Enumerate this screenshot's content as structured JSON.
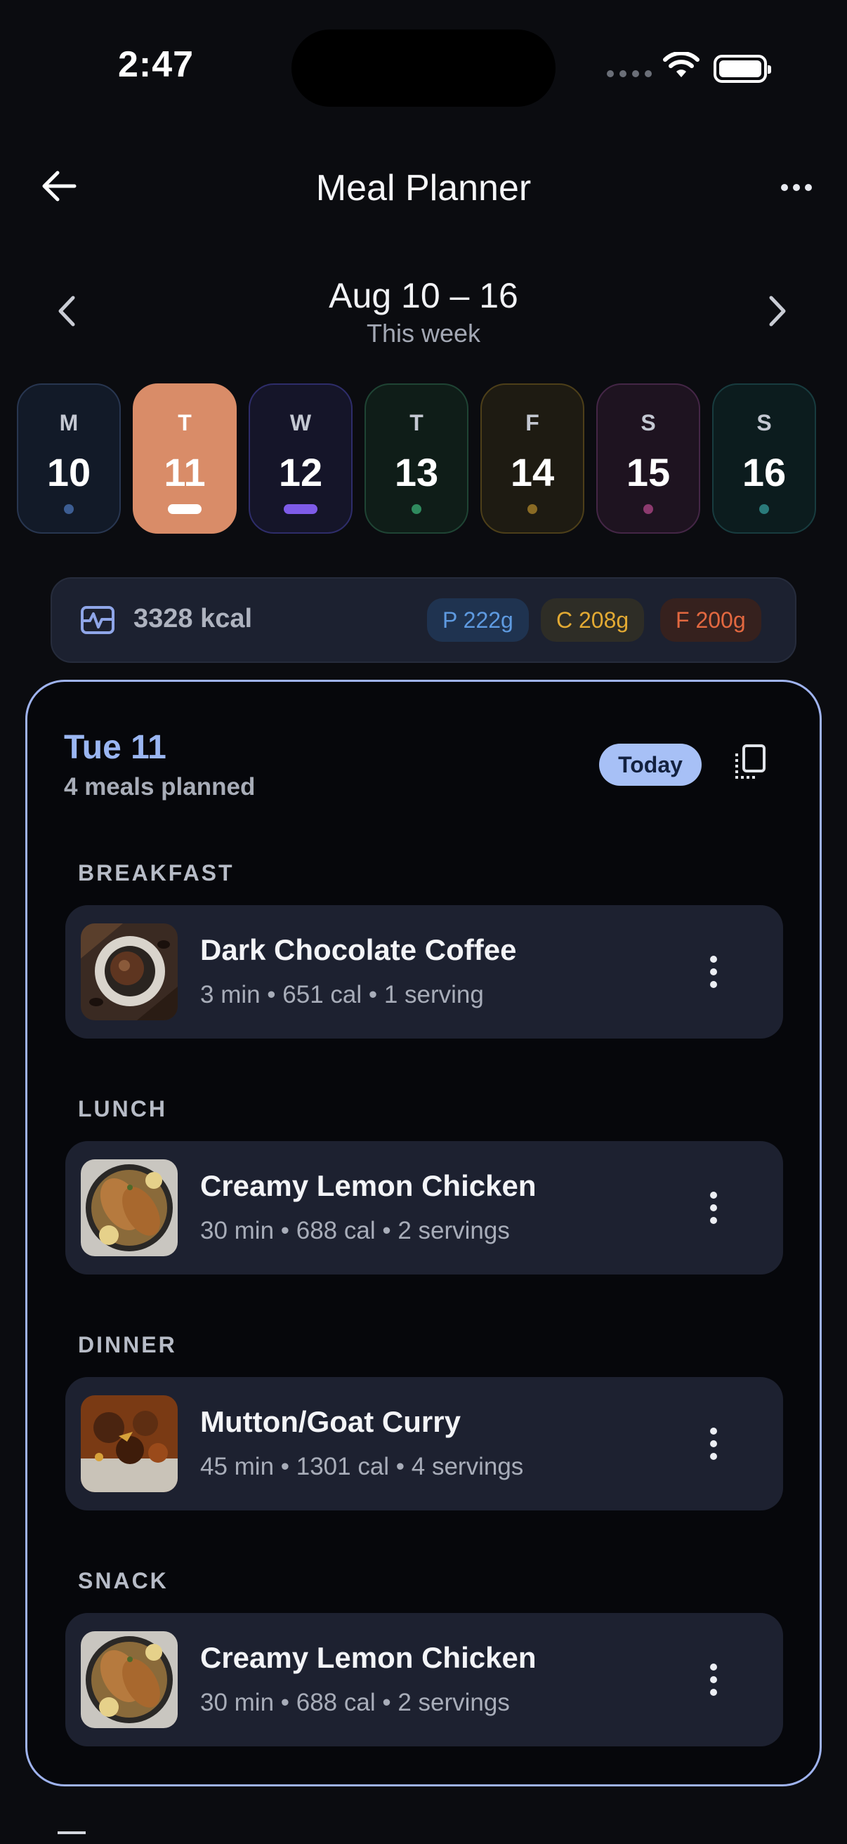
{
  "status_bar": {
    "time": "2:47"
  },
  "header": {
    "title": "Meal Planner",
    "back_icon": "arrow-left-icon",
    "menu_icon": "more-horizontal-icon"
  },
  "week": {
    "range": "Aug 10 – 16",
    "subtitle": "This week",
    "days": [
      {
        "letter": "M",
        "number": "10",
        "bg": "#121a28",
        "border": "#283650",
        "dot": "#3c5d92"
      },
      {
        "letter": "T",
        "number": "11",
        "bg": "#d98c68",
        "border": "#d98c68",
        "dot": "#ffffff",
        "selected": true
      },
      {
        "letter": "W",
        "number": "12",
        "bg": "#151529",
        "border": "#2e2d6a",
        "dot": "#7e5be8"
      },
      {
        "letter": "T",
        "number": "13",
        "bg": "#0f1d18",
        "border": "#1f4434",
        "dot": "#2f8a5e"
      },
      {
        "letter": "F",
        "number": "14",
        "bg": "#1e1b12",
        "border": "#4d3f19",
        "dot": "#8a6b24"
      },
      {
        "letter": "S",
        "number": "15",
        "bg": "#1e1320",
        "border": "#442646",
        "dot": "#8c3a6e"
      },
      {
        "letter": "S",
        "number": "16",
        "bg": "#0c1c1e",
        "border": "#183c3f",
        "dot": "#2a7a7a"
      }
    ]
  },
  "summary": {
    "kcal": "3328 kcal",
    "protein": "P 222g",
    "carbs": "C 208g",
    "fat": "F 200g"
  },
  "day_card": {
    "title": "Tue 11",
    "subtitle": "4 meals planned",
    "badge": "Today",
    "sections": [
      {
        "label": "BREAKFAST",
        "name": "Dark Chocolate Coffee",
        "meta": "3 min • 651 cal • 1 serving"
      },
      {
        "label": "LUNCH",
        "name": "Creamy Lemon Chicken",
        "meta": "30 min • 688 cal • 2 servings"
      },
      {
        "label": "DINNER",
        "name": "Mutton/Goat Curry",
        "meta": "45 min • 1301 cal • 4 servings"
      },
      {
        "label": "SNACK",
        "name": "Creamy Lemon Chicken",
        "meta": "30 min • 688 cal • 2 servings"
      }
    ]
  },
  "colors": {
    "accent": "#9fb3ef",
    "today_badge": "#a7c0f6",
    "selected_day": "#d98c68"
  }
}
